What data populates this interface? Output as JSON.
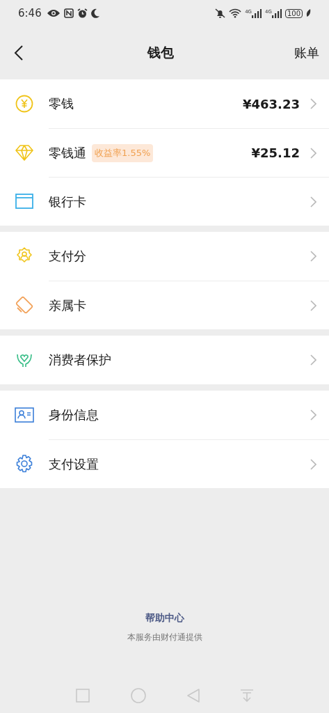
{
  "status_bar": {
    "time": "6:46",
    "signal_labels": [
      "4G",
      "4G"
    ],
    "battery": "100"
  },
  "nav": {
    "title": "钱包",
    "action": "账单"
  },
  "sections": [
    {
      "rows": [
        {
          "label": "零钱",
          "value": "¥463.23"
        },
        {
          "label": "零钱通",
          "badge": "收益率1.55%",
          "value": "¥25.12"
        },
        {
          "label": "银行卡"
        }
      ]
    },
    {
      "rows": [
        {
          "label": "支付分"
        },
        {
          "label": "亲属卡"
        }
      ]
    },
    {
      "rows": [
        {
          "label": "消费者保护"
        }
      ]
    },
    {
      "rows": [
        {
          "label": "身份信息"
        },
        {
          "label": "支付设置"
        }
      ]
    }
  ],
  "footer": {
    "link": "帮助中心",
    "note": "本服务由财付通提供"
  }
}
